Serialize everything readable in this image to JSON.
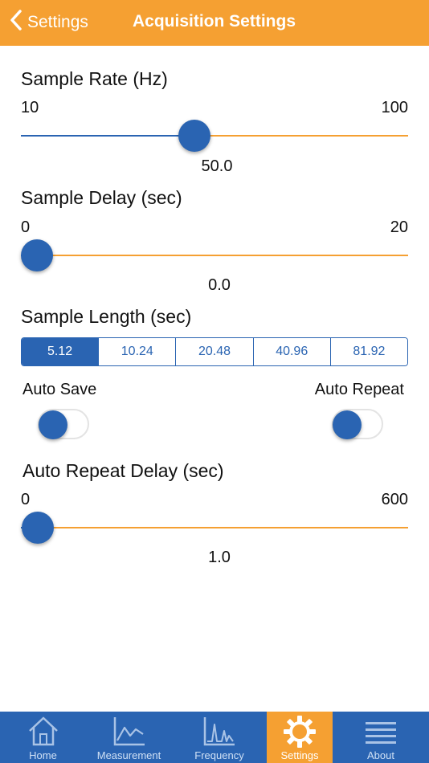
{
  "navbar": {
    "back_label": "Settings",
    "title": "Acquisition Settings"
  },
  "sample_rate": {
    "label": "Sample Rate (Hz)",
    "min": "10",
    "max": "100",
    "value": "50.0",
    "fraction": 0.444
  },
  "sample_delay": {
    "label": "Sample Delay (sec)",
    "min": "0",
    "max": "20",
    "value": "0.0",
    "fraction": 0.0
  },
  "sample_length": {
    "label": "Sample Length (sec)",
    "options": [
      "5.12",
      "10.24",
      "20.48",
      "40.96",
      "81.92"
    ],
    "selected": "5.12"
  },
  "auto_save": {
    "label": "Auto Save",
    "on": false
  },
  "auto_repeat": {
    "label": "Auto Repeat",
    "on": false
  },
  "auto_repeat_delay": {
    "label": "Auto Repeat Delay (sec)",
    "min": "0",
    "max": "600",
    "value": "1.0",
    "fraction": 0.0017
  },
  "tabs": [
    {
      "label": "Home",
      "icon": "home-icon"
    },
    {
      "label": "Measurement",
      "icon": "line-chart-icon"
    },
    {
      "label": "Frequency",
      "icon": "spectrum-chart-icon"
    },
    {
      "label": "Settings",
      "icon": "gear-icon",
      "active": true
    },
    {
      "label": "About",
      "icon": "list-icon"
    }
  ],
  "colors": {
    "accent_orange": "#f5a032",
    "primary_blue": "#2a64b2"
  }
}
